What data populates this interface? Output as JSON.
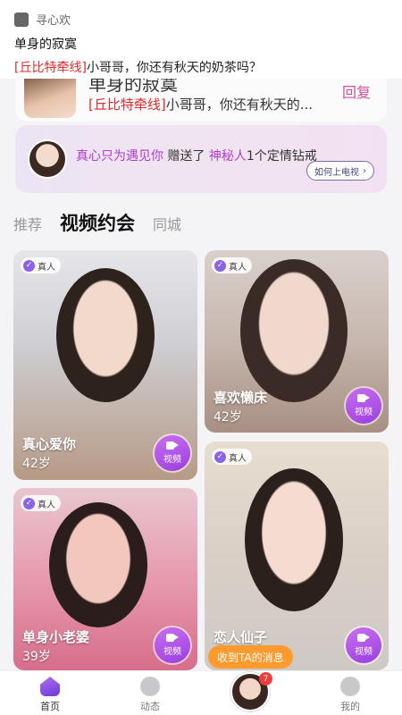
{
  "notification": {
    "app_name": "寻心欢",
    "title": "单身的寂寞",
    "message_tag": "[丘比特牵线]",
    "message_text": "小哥哥，你还有秋天的奶茶吗？"
  },
  "chat_peek": {
    "title": "单身的寂寞",
    "message_tag": "[丘比特牵线]",
    "message_text": "小哥哥，你还有秋天的...",
    "reply_label": "回复"
  },
  "gift_banner": {
    "sender": "真心只为遇见你",
    "action": "赠送了",
    "receiver": "神秘人",
    "gift": "1个定情钻戒",
    "button_label": "如何上电视"
  },
  "tabs": [
    {
      "label": "推荐",
      "active": false
    },
    {
      "label": "视频约会",
      "active": true
    },
    {
      "label": "同城",
      "active": false
    }
  ],
  "cards": [
    {
      "badge": "真人",
      "name": "真心爱你",
      "age": "42岁",
      "video_label": "视频"
    },
    {
      "badge": "真人",
      "name": "喜欢懒床",
      "age": "42岁",
      "video_label": "视频"
    },
    {
      "badge": "真人",
      "name": "单身小老婆",
      "age": "39岁",
      "video_label": "视频"
    },
    {
      "badge": "真人",
      "name": "恋人仙子",
      "age": "",
      "video_label": "视频"
    }
  ],
  "received_message_pill": "收到TA的消息",
  "unread_count": "7",
  "nav": [
    {
      "label": "首页",
      "active": true
    },
    {
      "label": "动态",
      "active": false
    },
    {
      "label": "我的",
      "active": false
    }
  ],
  "colors": {
    "accent_purple": "#9b3ee0",
    "tag_red": "#e02a2a",
    "pill_orange": "#ff9a2e"
  }
}
